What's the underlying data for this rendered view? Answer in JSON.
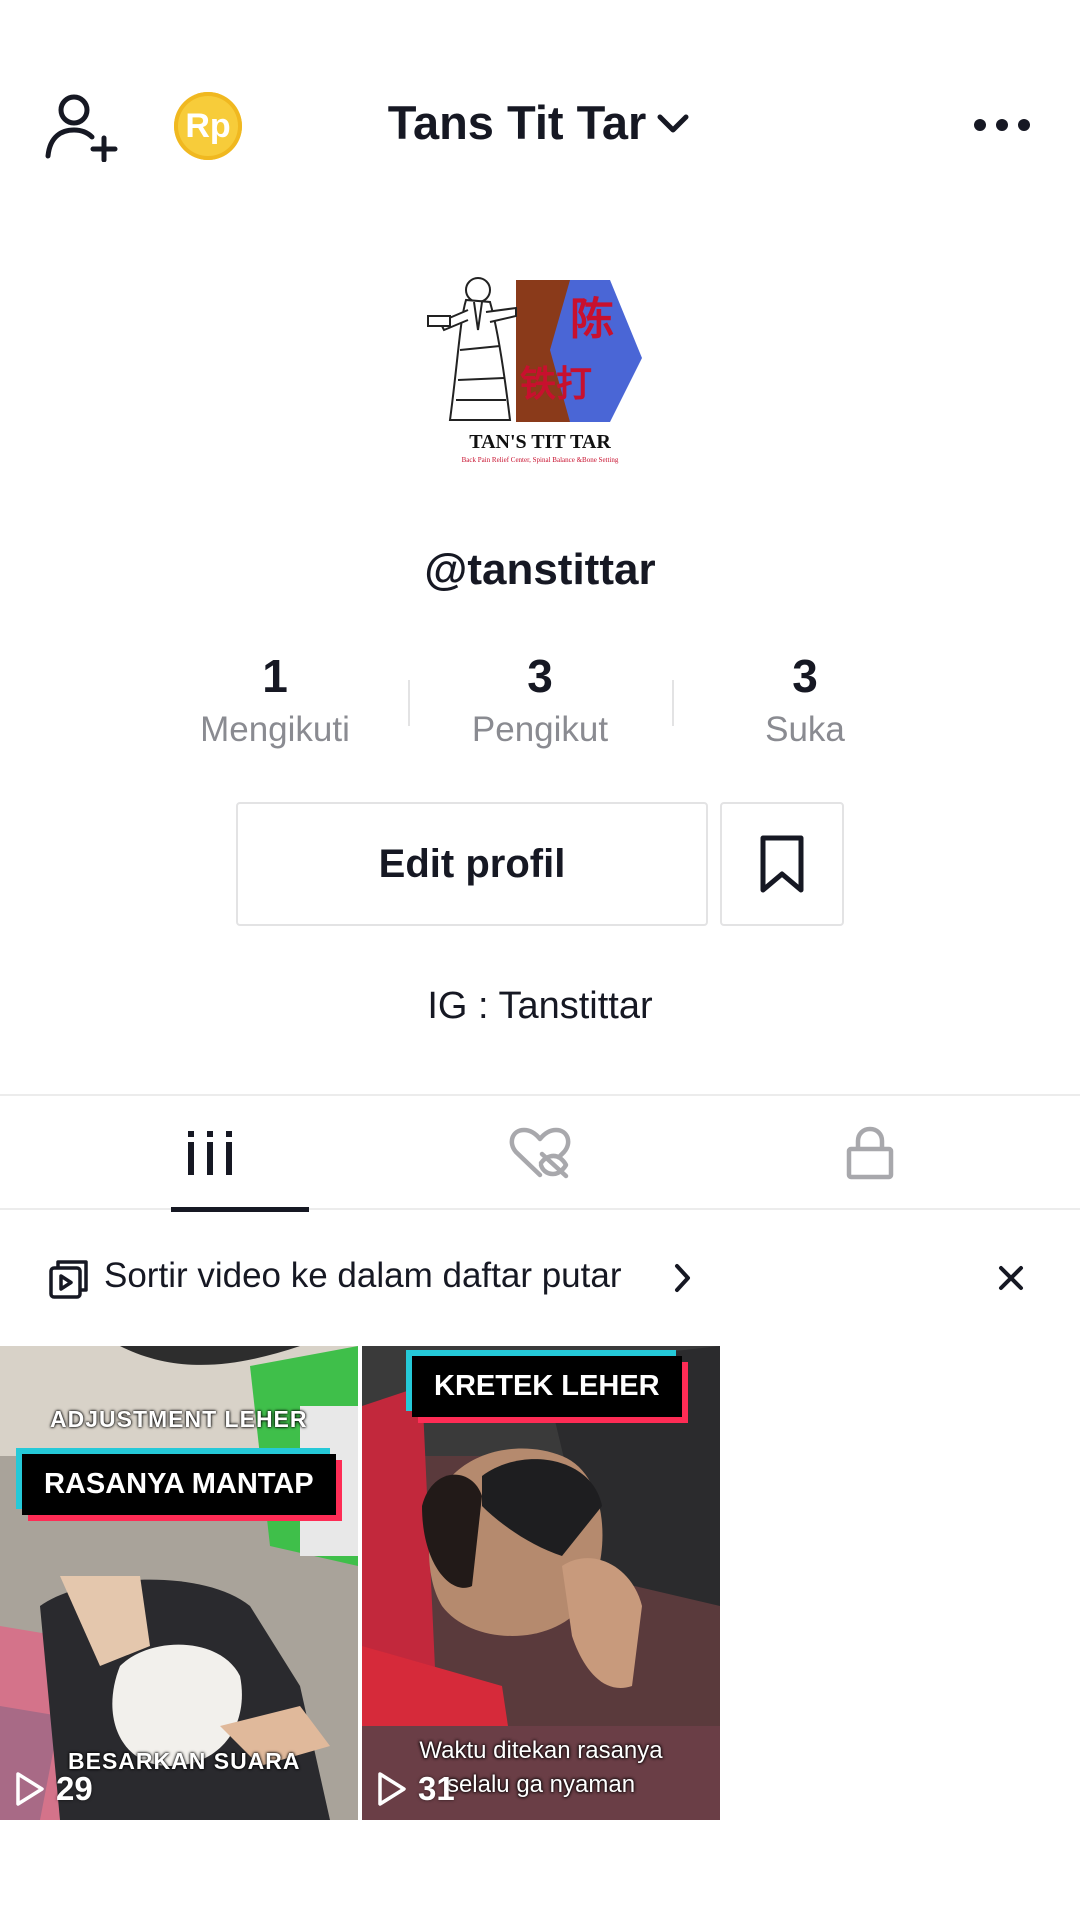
{
  "header": {
    "title": "Tans Tit Tar",
    "coin_label": "Rp"
  },
  "profile": {
    "avatar_title": "TAN'S TIT TAR",
    "avatar_subtitle": "Back Pain Relief Center, Spinal Balance &Bone Setting",
    "avatar_chars": [
      "陈",
      "铁打"
    ],
    "username": "@tanstittar",
    "bio": "IG : Tanstittar"
  },
  "stats": [
    {
      "value": "1",
      "label": "Mengikuti"
    },
    {
      "value": "3",
      "label": "Pengikut"
    },
    {
      "value": "3",
      "label": "Suka"
    }
  ],
  "actions": {
    "edit_label": "Edit profil"
  },
  "tabs": [
    {
      "name": "videos",
      "icon": "grid-icon",
      "active": true
    },
    {
      "name": "liked",
      "icon": "heart-hidden-icon",
      "active": false
    },
    {
      "name": "private",
      "icon": "lock-icon",
      "active": false
    }
  ],
  "banner": {
    "text": "Sortir video ke dalam daftar putar"
  },
  "videos": [
    {
      "top_caption": "ADJUSTMENT  LEHER",
      "tag": "RASANYA MANTAP",
      "bottom_caption": "BESARKAN  SUARA",
      "views": "29"
    },
    {
      "tag": "KRETEK LEHER",
      "subtitle_line1": "Waktu ditekan rasanya",
      "subtitle_line2": "selalu ga nyaman",
      "views": "31"
    }
  ],
  "colors": {
    "text": "#161823",
    "secondary_text": "#8a8b91",
    "coin": "#f7cc3a",
    "accent_cyan": "#25c9d8",
    "accent_red": "#fe2c55"
  }
}
